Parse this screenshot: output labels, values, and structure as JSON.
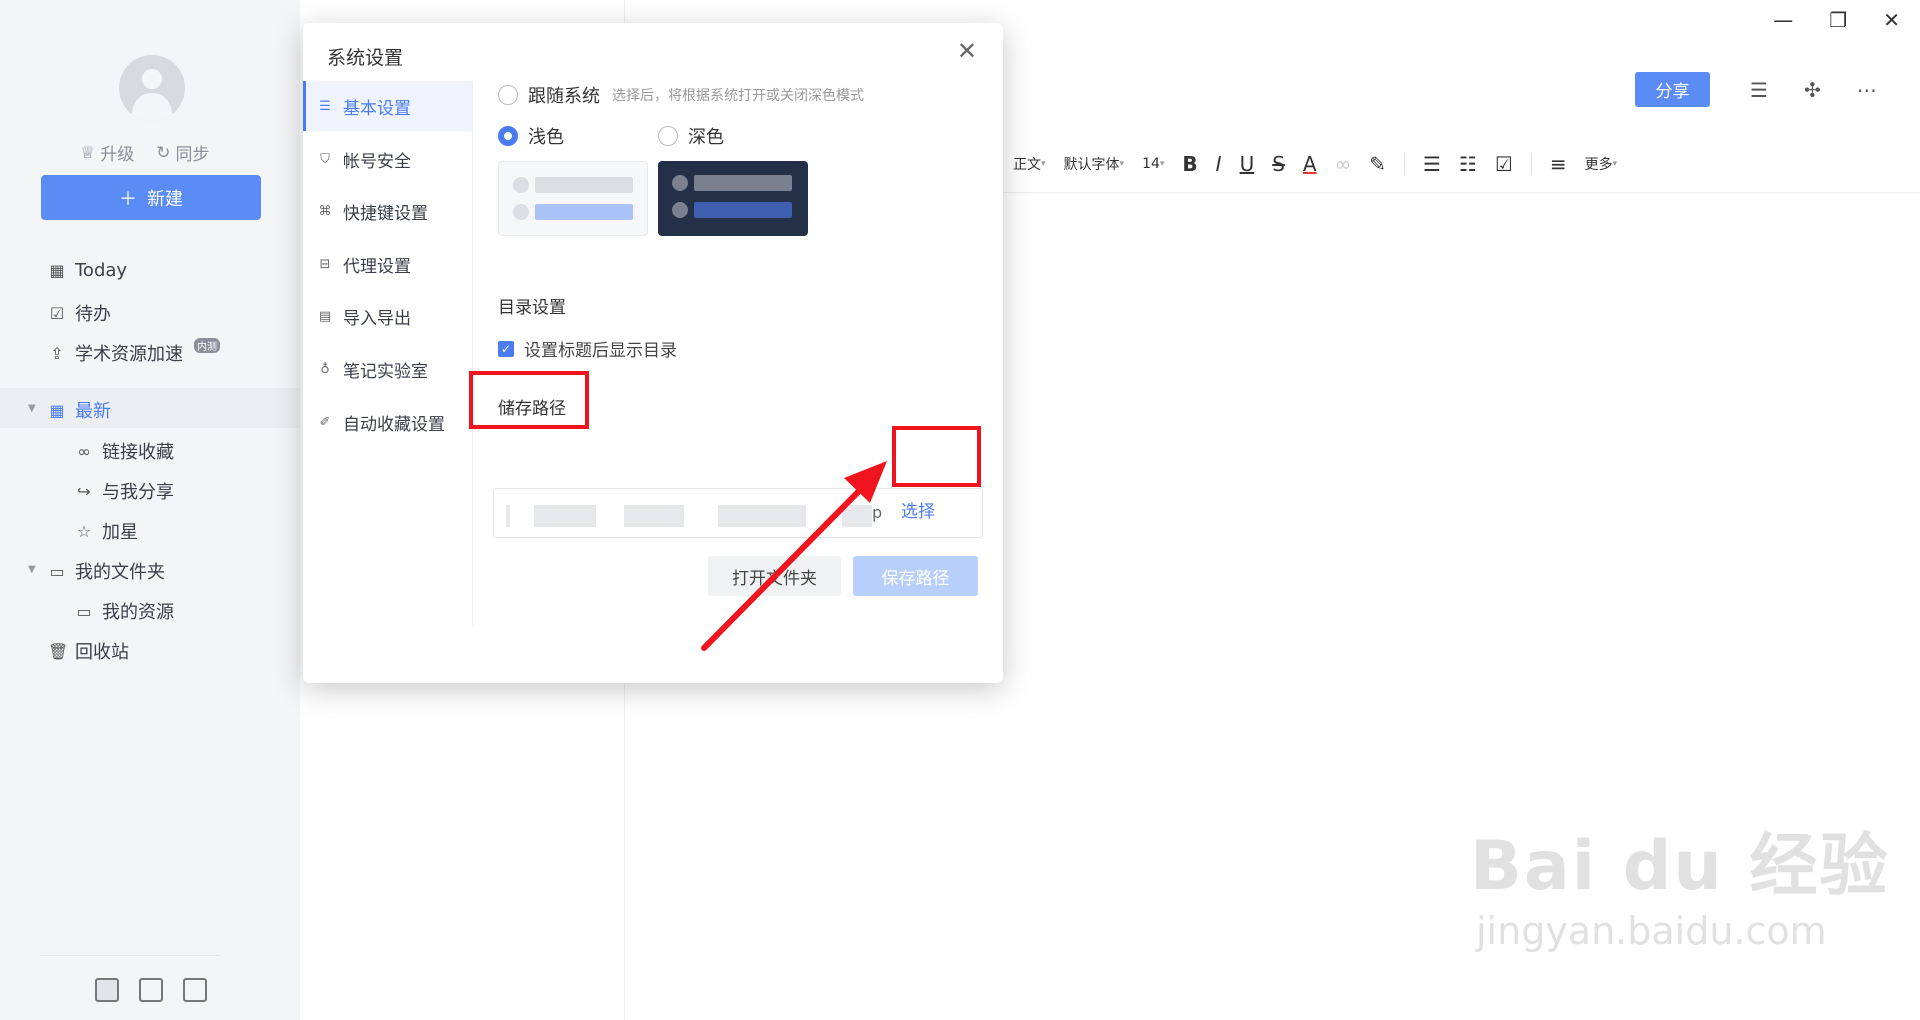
{
  "sidebar": {
    "upgrade_label": "升级",
    "sync_label": "同步",
    "new_button_label": "新建",
    "today_label": "Today",
    "todo_label": "待办",
    "academic_label": "学术资源加速",
    "academic_badge": "内测",
    "recent_label": "最新",
    "link_collect_label": "链接收藏",
    "shared_with_me_label": "与我分享",
    "starred_label": "加星",
    "my_folders_label": "我的文件夹",
    "my_resources_label": "我的资源",
    "trash_label": "回收站"
  },
  "editor": {
    "share_label": "分享",
    "toolbar": {
      "style_label": "正文",
      "font_label": "默认字体",
      "size_label": "14",
      "bold": "B",
      "italic": "I",
      "underline": "U",
      "strike": "S",
      "color": "A",
      "more_label": "更多"
    }
  },
  "dialog": {
    "title": "系统设置",
    "nav": {
      "basic": "基本设置",
      "account": "帐号安全",
      "shortcut": "快捷键设置",
      "proxy": "代理设置",
      "import_export": "导入导出",
      "lab": "笔记实验室",
      "auto_collect": "自动收藏设置"
    },
    "theme": {
      "follow_system_label": "跟随系统",
      "follow_system_hint": "选择后，将根据系统打开或关闭深色模式",
      "light_label": "浅色",
      "dark_label": "深色"
    },
    "toc": {
      "section_title": "目录设置",
      "checkbox_label": "设置标题后显示目录"
    },
    "storage": {
      "section_title": "储存路径",
      "path_tail": "p",
      "choose_label": "选择",
      "open_folder_label": "打开文件夹",
      "save_path_label": "保存路径"
    }
  },
  "watermark": {
    "main": "Bai du 经验",
    "sub": "jingyan.baidu.com"
  },
  "colors": {
    "accent": "#4a7cf0",
    "primary_button": "#5b8cf5",
    "annotation_red": "#f0141e",
    "dark_theme_card": "#243047"
  }
}
